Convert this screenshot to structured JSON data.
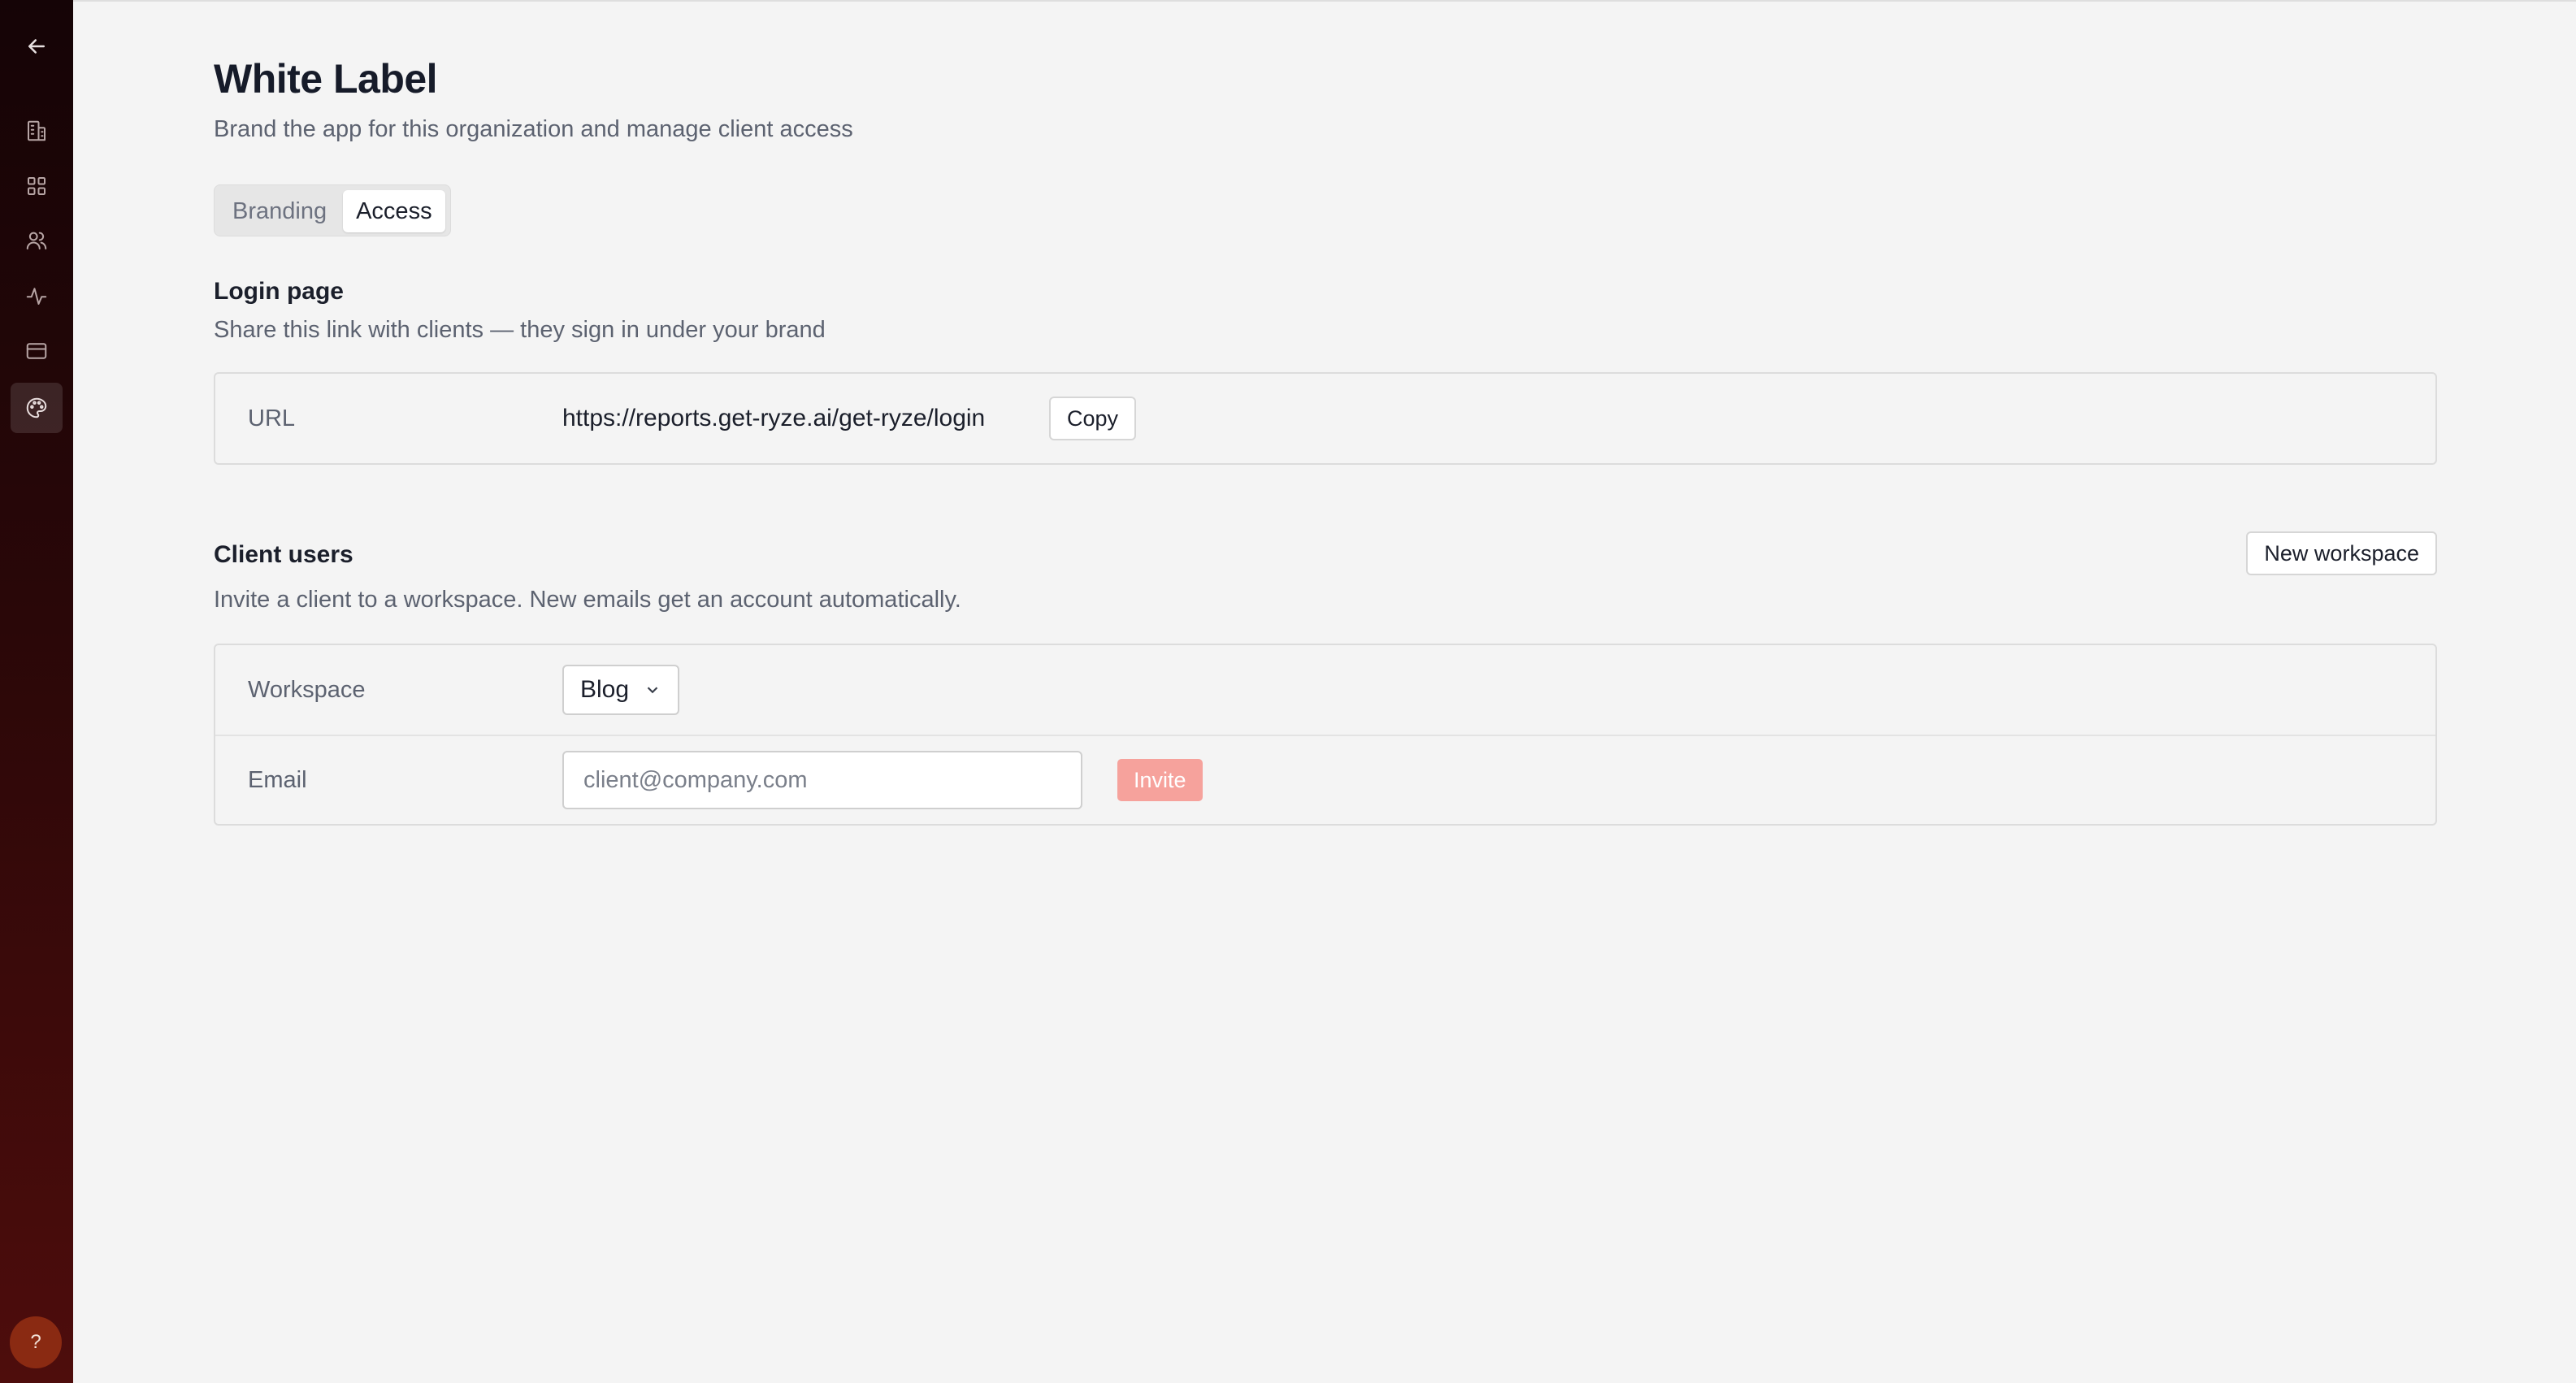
{
  "sidebar": {
    "items": [
      {
        "name": "back",
        "icon": "arrow-left-icon"
      },
      {
        "name": "organization",
        "icon": "building-icon"
      },
      {
        "name": "apps",
        "icon": "grid-icon"
      },
      {
        "name": "users",
        "icon": "users-icon"
      },
      {
        "name": "activity",
        "icon": "activity-icon"
      },
      {
        "name": "billing",
        "icon": "credit-card-icon"
      },
      {
        "name": "white-label",
        "icon": "palette-icon",
        "active": true
      }
    ],
    "help_label": "?"
  },
  "page": {
    "title": "White Label",
    "subtitle": "Brand the app for this organization and manage client access"
  },
  "tabs": [
    {
      "label": "Branding",
      "active": false
    },
    {
      "label": "Access",
      "active": true
    }
  ],
  "login_page": {
    "title": "Login page",
    "description": "Share this link with clients — they sign in under your brand",
    "url_label": "URL",
    "url_value": "https://reports.get-ryze.ai/get-ryze/login",
    "copy_label": "Copy"
  },
  "client_users": {
    "title": "Client users",
    "description": "Invite a client to a workspace. New emails get an account automatically.",
    "new_workspace_label": "New workspace",
    "workspace_label": "Workspace",
    "workspace_selected": "Blog",
    "email_label": "Email",
    "email_placeholder": "client@company.com",
    "email_value": "",
    "invite_label": "Invite"
  },
  "colors": {
    "accent": "#f6a29c",
    "sidebar_top": "#150406",
    "sidebar_bottom": "#4e0d0c",
    "help_button": "#8a2a12"
  }
}
